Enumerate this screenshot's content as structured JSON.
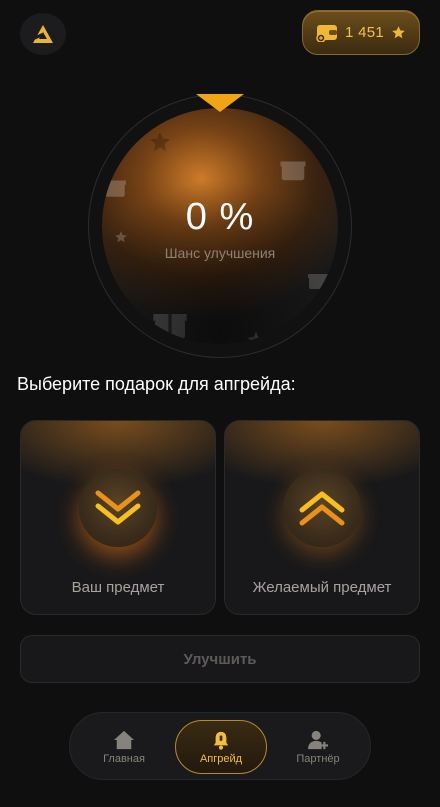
{
  "header": {
    "logo_icon": "triangle-logo-icon",
    "balance": "1 451",
    "balance_icons": [
      "wallet-icon",
      "star-icon"
    ]
  },
  "wheel": {
    "chance_value": "0 %",
    "chance_label": "Шанс улучшения",
    "accent": "#f0a416"
  },
  "section_title": "Выберите подарок для апгрейда:",
  "cards": {
    "left_label": "Ваш предмет",
    "right_label": "Желаемый предмет"
  },
  "improve_button": "Улучшить",
  "nav": {
    "items": [
      {
        "label": "Главная",
        "icon": "home-icon"
      },
      {
        "label": "Апгрейд",
        "icon": "bell-icon"
      },
      {
        "label": "Партнёр",
        "icon": "add-user-icon"
      }
    ],
    "active": "Апгрейд"
  }
}
